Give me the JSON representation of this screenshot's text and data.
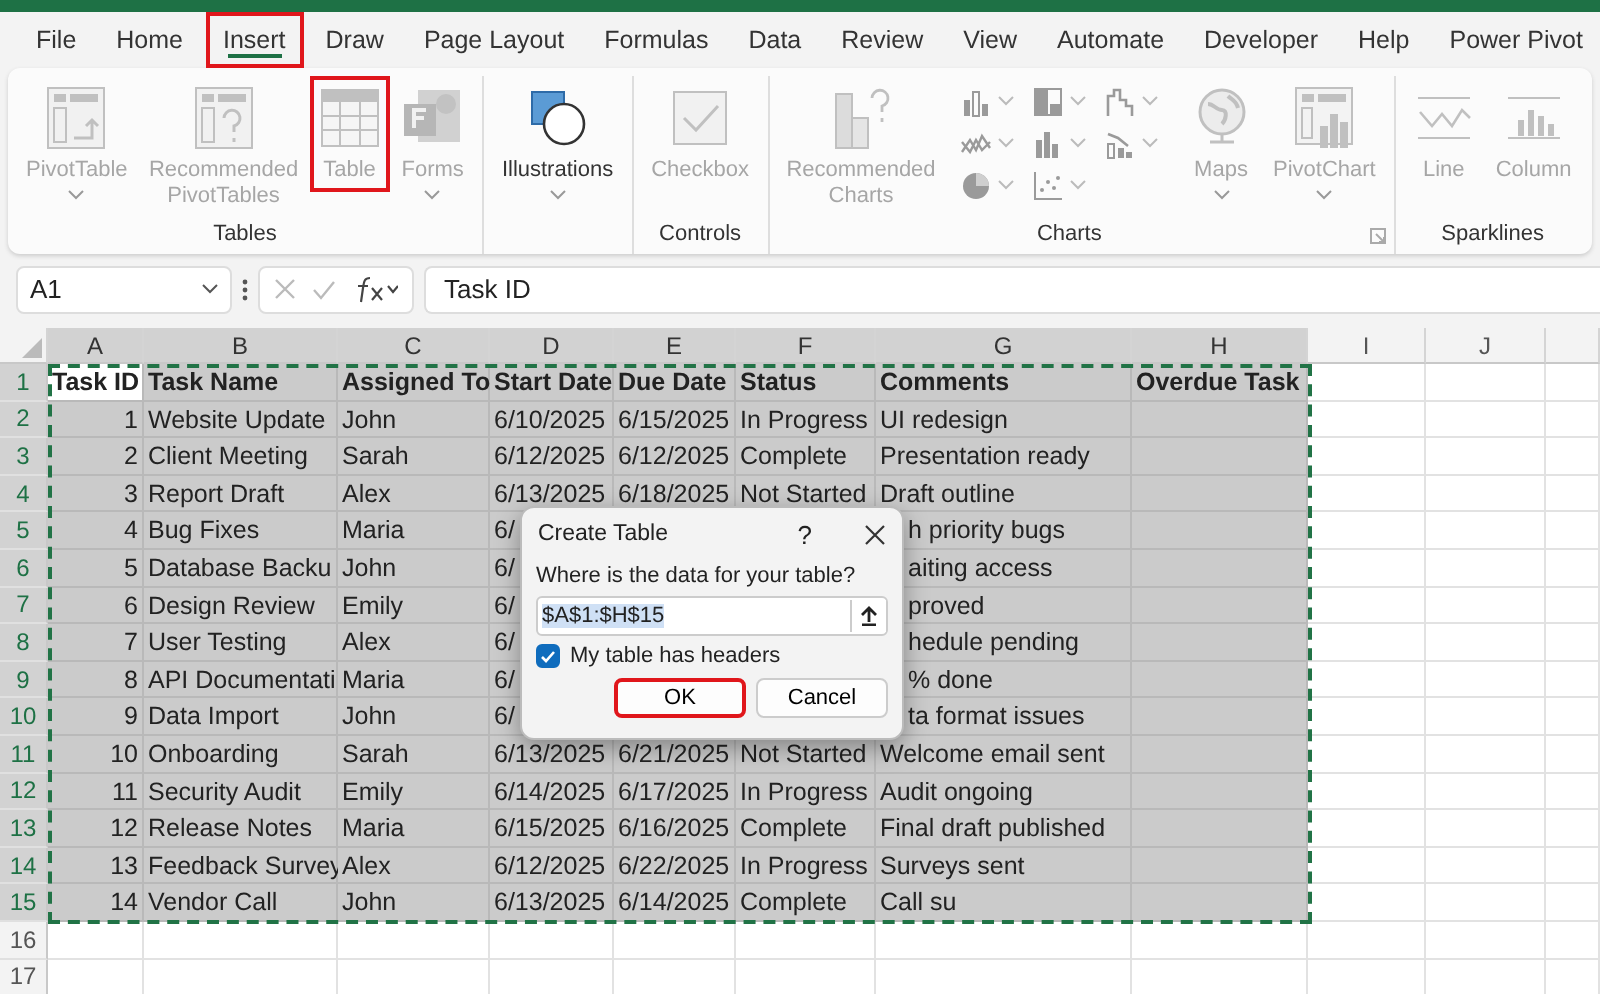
{
  "menu_tabs": [
    {
      "label": "File",
      "selected": false,
      "highlighted": false
    },
    {
      "label": "Home",
      "selected": false,
      "highlighted": false
    },
    {
      "label": "Insert",
      "selected": true,
      "highlighted": true
    },
    {
      "label": "Draw",
      "selected": false,
      "highlighted": false
    },
    {
      "label": "Page Layout",
      "selected": false,
      "highlighted": false
    },
    {
      "label": "Formulas",
      "selected": false,
      "highlighted": false
    },
    {
      "label": "Data",
      "selected": false,
      "highlighted": false
    },
    {
      "label": "Review",
      "selected": false,
      "highlighted": false
    },
    {
      "label": "View",
      "selected": false,
      "highlighted": false
    },
    {
      "label": "Automate",
      "selected": false,
      "highlighted": false
    },
    {
      "label": "Developer",
      "selected": false,
      "highlighted": false
    },
    {
      "label": "Help",
      "selected": false,
      "highlighted": false
    },
    {
      "label": "Power Pivot",
      "selected": false,
      "highlighted": false
    }
  ],
  "ribbon": {
    "groups": [
      {
        "label": "Tables",
        "launcher": false,
        "buttons": [
          {
            "kind": "pivot-table",
            "label": "PivotTable",
            "dropdown": true,
            "disabled": true,
            "highlighted": false
          },
          {
            "kind": "recommended-pivot",
            "label": "Recommended PivotTables",
            "dropdown": false,
            "disabled": true,
            "highlighted": false
          },
          {
            "kind": "table",
            "label": "Table",
            "dropdown": false,
            "disabled": true,
            "highlighted": true
          },
          {
            "kind": "forms",
            "label": "Forms",
            "dropdown": true,
            "disabled": true,
            "highlighted": false
          }
        ]
      },
      {
        "launcher": false,
        "buttons": [
          {
            "kind": "illustrations",
            "label": "Illustrations",
            "dropdown": true,
            "disabled": false,
            "highlighted": false
          }
        ]
      },
      {
        "label": "Controls",
        "launcher": false,
        "buttons": [
          {
            "kind": "checkbox",
            "label": "Checkbox",
            "dropdown": false,
            "disabled": true,
            "highlighted": false
          }
        ]
      },
      {
        "label": "Charts",
        "launcher": true,
        "buttons": [
          {
            "kind": "recommended-charts",
            "label": "Recommended Charts",
            "dropdown": false,
            "disabled": true,
            "highlighted": false
          },
          {
            "kind": "chart-grid",
            "items": [
              {
                "kind": "column"
              },
              {
                "kind": "hierarchy"
              },
              {
                "kind": "waterfall"
              },
              {
                "kind": "line"
              },
              {
                "kind": "statistic"
              },
              {
                "kind": "combo"
              },
              {
                "kind": "pie"
              },
              {
                "kind": "scatter"
              }
            ]
          },
          {
            "kind": "maps",
            "label": "Maps",
            "dropdown": true,
            "disabled": true,
            "highlighted": false
          },
          {
            "kind": "pivot-chart",
            "label": "PivotChart",
            "dropdown": true,
            "disabled": true,
            "highlighted": false
          }
        ]
      },
      {
        "label": "Sparklines",
        "launcher": false,
        "buttons": [
          {
            "kind": "line-sparkline",
            "label": "Line",
            "dropdown": false,
            "disabled": true,
            "highlighted": false
          },
          {
            "kind": "column-sparkline",
            "label": "Column",
            "dropdown": false,
            "disabled": true,
            "highlighted": false
          }
        ]
      }
    ]
  },
  "formula_bar": {
    "name_box": "A1",
    "formula": "Task ID"
  },
  "sheet": {
    "columns": [
      {
        "label": "A",
        "selected": true
      },
      {
        "label": "B",
        "selected": true
      },
      {
        "label": "C",
        "selected": true
      },
      {
        "label": "D",
        "selected": true
      },
      {
        "label": "E",
        "selected": true
      },
      {
        "label": "F",
        "selected": true
      },
      {
        "label": "G",
        "selected": true
      },
      {
        "label": "H",
        "selected": true
      },
      {
        "label": "I",
        "selected": false
      },
      {
        "label": "J",
        "selected": false
      }
    ],
    "rows": [
      {
        "number": "1",
        "kind": "header",
        "selected": true,
        "active_cell": true,
        "cells": [
          "Task ID",
          "Task Name",
          "Assigned To",
          "Start Date",
          "Due Date",
          "Status",
          "Comments",
          "Overdue Task"
        ]
      },
      {
        "number": "2",
        "kind": "data",
        "selected": true,
        "cells": [
          "1",
          "Website Update",
          "John",
          "6/10/2025",
          "6/15/2025",
          "In Progress",
          "UI redesign"
        ]
      },
      {
        "number": "3",
        "kind": "data",
        "selected": true,
        "cells": [
          "2",
          "Client Meeting",
          "Sarah",
          "6/12/2025",
          "6/12/2025",
          "Complete",
          "Presentation ready"
        ]
      },
      {
        "number": "4",
        "kind": "data",
        "selected": true,
        "cells": [
          "3",
          "Report Draft",
          "Alex",
          "6/13/2025",
          "6/18/2025",
          "Not Started",
          "Draft outline"
        ]
      },
      {
        "number": "5",
        "kind": "data",
        "selected": true,
        "cells": [
          "4",
          "Bug Fixes",
          "Maria",
          "6/",
          null,
          null,
          "h priority bugs"
        ]
      },
      {
        "number": "6",
        "kind": "data",
        "selected": true,
        "cells": [
          "5",
          "Database Backu",
          "John",
          "6/",
          null,
          null,
          "aiting access"
        ]
      },
      {
        "number": "7",
        "kind": "data",
        "selected": true,
        "cells": [
          "6",
          "Design Review",
          "Emily",
          "6/",
          null,
          null,
          "proved"
        ]
      },
      {
        "number": "8",
        "kind": "data",
        "selected": true,
        "cells": [
          "7",
          "User Testing",
          "Alex",
          "6/",
          null,
          null,
          "hedule pending"
        ]
      },
      {
        "number": "9",
        "kind": "data",
        "selected": true,
        "cells": [
          "8",
          "API Documentati",
          "Maria",
          "6/",
          null,
          null,
          "% done"
        ]
      },
      {
        "number": "10",
        "kind": "data",
        "selected": true,
        "cells": [
          "9",
          "Data Import",
          "John",
          "6/",
          null,
          null,
          "ta format issues"
        ]
      },
      {
        "number": "11",
        "kind": "data",
        "selected": true,
        "cells": [
          "10",
          "Onboarding",
          "Sarah",
          "6/13/2025",
          "6/21/2025",
          "Not Started",
          "Welcome email sent"
        ]
      },
      {
        "number": "12",
        "kind": "data",
        "selected": true,
        "cells": [
          "11",
          "Security Audit",
          "Emily",
          "6/14/2025",
          "6/17/2025",
          "In Progress",
          "Audit ongoing"
        ]
      },
      {
        "number": "13",
        "kind": "data",
        "selected": true,
        "cells": [
          "12",
          "Release Notes",
          "Maria",
          "6/15/2025",
          "6/16/2025",
          "Complete",
          "Final draft published"
        ]
      },
      {
        "number": "14",
        "kind": "data",
        "selected": true,
        "cells": [
          "13",
          "Feedback Survey",
          "Alex",
          "6/12/2025",
          "6/22/2025",
          "In Progress",
          "Surveys sent"
        ]
      },
      {
        "number": "15",
        "kind": "data",
        "selected": true,
        "cells": [
          "14",
          "Vendor Call",
          "John",
          "6/13/2025",
          "6/14/2025",
          "Complete",
          "Call su"
        ]
      },
      {
        "number": "16",
        "kind": "data",
        "selected": false,
        "cells": []
      },
      {
        "number": "17",
        "kind": "data",
        "selected": false,
        "cells": []
      }
    ]
  },
  "dialog": {
    "title": "Create Table",
    "help": "?",
    "prompt": "Where is the data for your table?",
    "range": "$A$1:$H$15",
    "headers_label": "My table has headers",
    "headers_checked": true,
    "buttons": [
      {
        "label": "OK",
        "default": true,
        "highlighted": true
      },
      {
        "label": "Cancel",
        "default": false,
        "highlighted": false
      }
    ]
  }
}
